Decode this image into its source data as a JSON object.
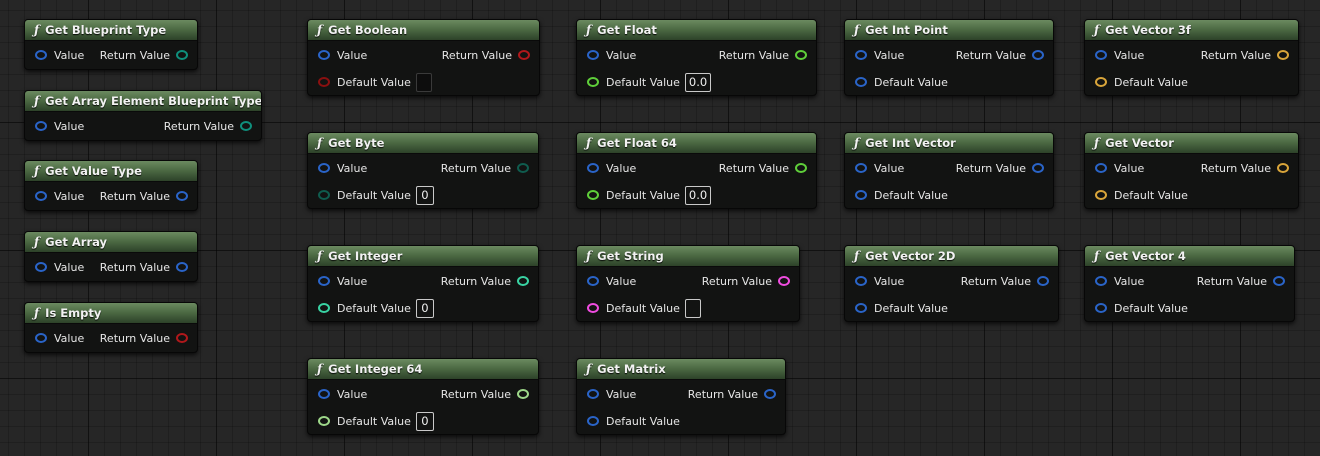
{
  "colors": {
    "header_top": "#6b8a60",
    "header_bottom": "#2d4229",
    "node_body": "#121312",
    "pin_blue": "#2a64c8",
    "pin_teal": "#0f8f7c",
    "pin_red": "#b0181b",
    "pin_green": "#5fcf3a",
    "pin_darkteal": "#0f5c4e",
    "pin_mint": "#39d3a3",
    "pin_lightgreen": "#9ed88a",
    "pin_magenta": "#f04ce0",
    "pin_gold": "#d9a53a",
    "pin_darkred": "#8a1010"
  },
  "nodes": [
    {
      "title": "Get Blueprint Type",
      "rows": [
        {
          "left": "Value",
          "left_pin": "blue",
          "right": "Return Value",
          "right_pin": "teal"
        }
      ]
    },
    {
      "title": "Get Array Element Blueprint Type",
      "rows": [
        {
          "left": "Value",
          "left_pin": "blue",
          "right": "Return Value",
          "right_pin": "teal"
        }
      ]
    },
    {
      "title": "Get Value Type",
      "rows": [
        {
          "left": "Value",
          "left_pin": "blue",
          "right": "Return Value",
          "right_pin": "blue"
        }
      ]
    },
    {
      "title": "Get Array",
      "rows": [
        {
          "left": "Value",
          "left_pin": "blue",
          "right": "Return Value",
          "right_pin": "blue"
        }
      ]
    },
    {
      "title": "Is Empty",
      "rows": [
        {
          "left": "Value",
          "left_pin": "blue",
          "right": "Return Value",
          "right_pin": "red"
        }
      ]
    },
    {
      "title": "Get Boolean",
      "rows": [
        {
          "left": "Value",
          "left_pin": "blue",
          "right": "Return Value",
          "right_pin": "red"
        },
        {
          "left": "Default Value",
          "left_pin": "darkred",
          "default_box": "check"
        }
      ]
    },
    {
      "title": "Get Byte",
      "rows": [
        {
          "left": "Value",
          "left_pin": "blue",
          "right": "Return Value",
          "right_pin": "darkteal"
        },
        {
          "left": "Default Value",
          "left_pin": "darkteal",
          "default": "0"
        }
      ]
    },
    {
      "title": "Get Integer",
      "rows": [
        {
          "left": "Value",
          "left_pin": "blue",
          "right": "Return Value",
          "right_pin": "mint"
        },
        {
          "left": "Default Value",
          "left_pin": "mint",
          "default": "0"
        }
      ]
    },
    {
      "title": "Get Integer 64",
      "rows": [
        {
          "left": "Value",
          "left_pin": "blue",
          "right": "Return Value",
          "right_pin": "lightgreen"
        },
        {
          "left": "Default Value",
          "left_pin": "lightgreen",
          "default": "0"
        }
      ]
    },
    {
      "title": "Get Float",
      "rows": [
        {
          "left": "Value",
          "left_pin": "blue",
          "right": "Return Value",
          "right_pin": "green"
        },
        {
          "left": "Default Value",
          "left_pin": "green",
          "default": "0.0"
        }
      ]
    },
    {
      "title": "Get Float 64",
      "rows": [
        {
          "left": "Value",
          "left_pin": "blue",
          "right": "Return Value",
          "right_pin": "green"
        },
        {
          "left": "Default Value",
          "left_pin": "green",
          "default": "0.0"
        }
      ]
    },
    {
      "title": "Get String",
      "rows": [
        {
          "left": "Value",
          "left_pin": "blue",
          "right": "Return Value",
          "right_pin": "magenta"
        },
        {
          "left": "Default Value",
          "left_pin": "magenta",
          "default_box": "empty"
        }
      ]
    },
    {
      "title": "Get Matrix",
      "rows": [
        {
          "left": "Value",
          "left_pin": "blue",
          "right": "Return Value",
          "right_pin": "blue"
        },
        {
          "left": "Default Value",
          "left_pin": "blue"
        }
      ]
    },
    {
      "title": "Get Int Point",
      "rows": [
        {
          "left": "Value",
          "left_pin": "blue",
          "right": "Return Value",
          "right_pin": "blue"
        },
        {
          "left": "Default Value",
          "left_pin": "blue"
        }
      ]
    },
    {
      "title": "Get Int Vector",
      "rows": [
        {
          "left": "Value",
          "left_pin": "blue",
          "right": "Return Value",
          "right_pin": "blue"
        },
        {
          "left": "Default Value",
          "left_pin": "blue"
        }
      ]
    },
    {
      "title": "Get Vector 2D",
      "rows": [
        {
          "left": "Value",
          "left_pin": "blue",
          "right": "Return Value",
          "right_pin": "blue"
        },
        {
          "left": "Default Value",
          "left_pin": "blue"
        }
      ]
    },
    {
      "title": "Get Vector 3f",
      "rows": [
        {
          "left": "Value",
          "left_pin": "blue",
          "right": "Return Value",
          "right_pin": "gold"
        },
        {
          "left": "Default Value",
          "left_pin": "gold"
        }
      ]
    },
    {
      "title": "Get Vector",
      "rows": [
        {
          "left": "Value",
          "left_pin": "blue",
          "right": "Return Value",
          "right_pin": "gold"
        },
        {
          "left": "Default Value",
          "left_pin": "gold"
        }
      ]
    },
    {
      "title": "Get Vector 4",
      "rows": [
        {
          "left": "Value",
          "left_pin": "blue",
          "right": "Return Value",
          "right_pin": "blue"
        },
        {
          "left": "Default Value",
          "left_pin": "blue"
        }
      ]
    }
  ]
}
